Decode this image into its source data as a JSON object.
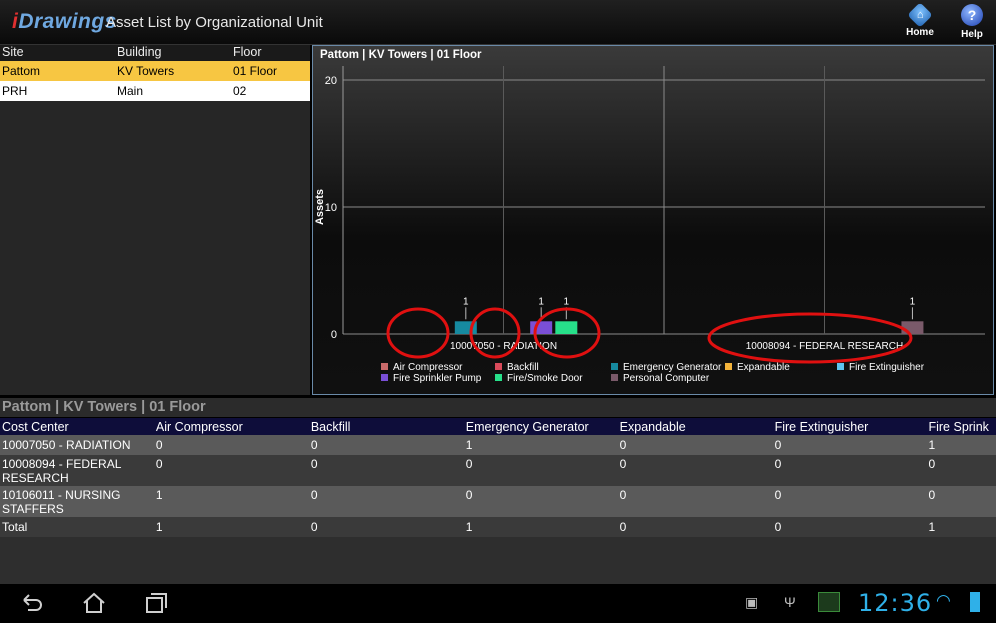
{
  "app": {
    "logo_prefix": "i",
    "logo_rest": "Drawings",
    "title": "Asset List by Organizational Unit",
    "home_label": "Home",
    "help_label": "Help"
  },
  "site_table": {
    "headers": [
      "Site",
      "Building",
      "Floor"
    ],
    "rows": [
      {
        "site": "Pattom",
        "building": "KV Towers",
        "floor": "01 Floor"
      },
      {
        "site": "PRH",
        "building": "Main",
        "floor": "02"
      }
    ]
  },
  "chart_data": {
    "type": "bar",
    "title": "Pattom | KV Towers | 01 Floor",
    "ylabel": "Assets",
    "xlabel": "",
    "ylim": [
      0,
      20
    ],
    "yticks": [
      0,
      10,
      20
    ],
    "grid": true,
    "categories": [
      "10007050 - RADIATION",
      "10008094 - FEDERAL RESEARCH"
    ],
    "series": [
      {
        "name": "Air Compressor",
        "color": "#c96a6a",
        "values": [
          0,
          0
        ]
      },
      {
        "name": "Backfill",
        "color": "#d94a5a",
        "values": [
          0,
          0
        ]
      },
      {
        "name": "Emergency Generator",
        "color": "#168aa0",
        "values": [
          1,
          0
        ]
      },
      {
        "name": "Expandable",
        "color": "#f2b23a",
        "values": [
          0,
          0
        ]
      },
      {
        "name": "Fire Extinguisher",
        "color": "#5fc4f0",
        "values": [
          0,
          0
        ]
      },
      {
        "name": "Fire Sprinkler Pump",
        "color": "#7a4fd6",
        "values": [
          1,
          0
        ]
      },
      {
        "name": "Fire/Smoke Door",
        "color": "#27e08a",
        "values": [
          1,
          0
        ]
      },
      {
        "name": "Personal Computer",
        "color": "#7a5a6a",
        "values": [
          0,
          1
        ]
      }
    ],
    "legend_position": "bottom"
  },
  "table_title": "Pattom | KV Towers | 01 Floor",
  "data_table": {
    "headers": [
      "Cost Center",
      "Air Compressor",
      "Backfill",
      "Emergency Generator",
      "Expandable",
      "Fire Extinguisher",
      "Fire Sprink"
    ],
    "rows": [
      [
        "10007050 - RADIATION",
        "0",
        "0",
        "1",
        "0",
        "0",
        "1"
      ],
      [
        "10008094 - FEDERAL RESEARCH",
        "0",
        "0",
        "0",
        "0",
        "0",
        "0"
      ],
      [
        "10106011 - NURSING STAFFERS",
        "1",
        "0",
        "0",
        "0",
        "0",
        "0"
      ],
      [
        "Total",
        "1",
        "0",
        "1",
        "0",
        "0",
        "1"
      ]
    ]
  },
  "status_bar": {
    "time": "12:36"
  },
  "colors": {
    "selected_row": "#f7c642",
    "table_header": "#0e0d3a",
    "accent_clock": "#2fb0e8",
    "annotation_circle": "#e01010"
  }
}
